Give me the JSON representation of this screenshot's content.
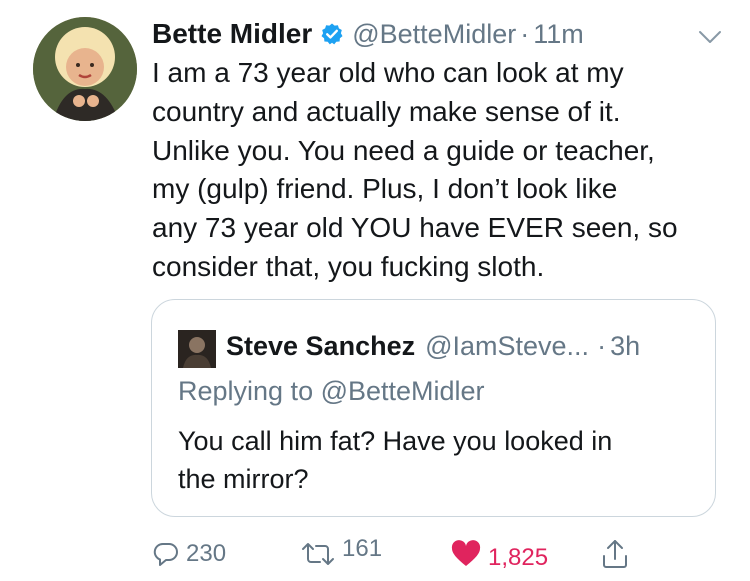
{
  "tweet": {
    "author_name": "Bette Midler",
    "handle": "@BetteMidler",
    "separator": "·",
    "time": "11m",
    "text": "I am a 73 year old who can look at my\ncountry and actually make sense of it.\nUnlike you. You need a guide or teacher,\nmy (gulp) friend.  Plus, I don’t look like\nany 73 year old YOU have EVER seen, so\nconsider that, you fucking sloth.",
    "verified": true
  },
  "quoted_tweet": {
    "author_name": "Steve Sanchez",
    "handle": "@IamSteve...",
    "separator": "·",
    "time": "3h",
    "replying_to": "Replying to @BetteMidler",
    "text": "You call him fat? Have you looked in\nthe mirror?"
  },
  "actions": {
    "replies": "230",
    "retweets": "161",
    "likes": "1,825",
    "liked": true
  },
  "colors": {
    "text": "#14171a",
    "secondary": "#657786",
    "verified_blue": "#1da1f2",
    "like_red": "#e0245e",
    "border": "#ccd6dd"
  },
  "icons": [
    "verified-badge-icon",
    "chevron-down-icon",
    "reply-icon",
    "retweet-icon",
    "heart-icon",
    "share-icon"
  ]
}
